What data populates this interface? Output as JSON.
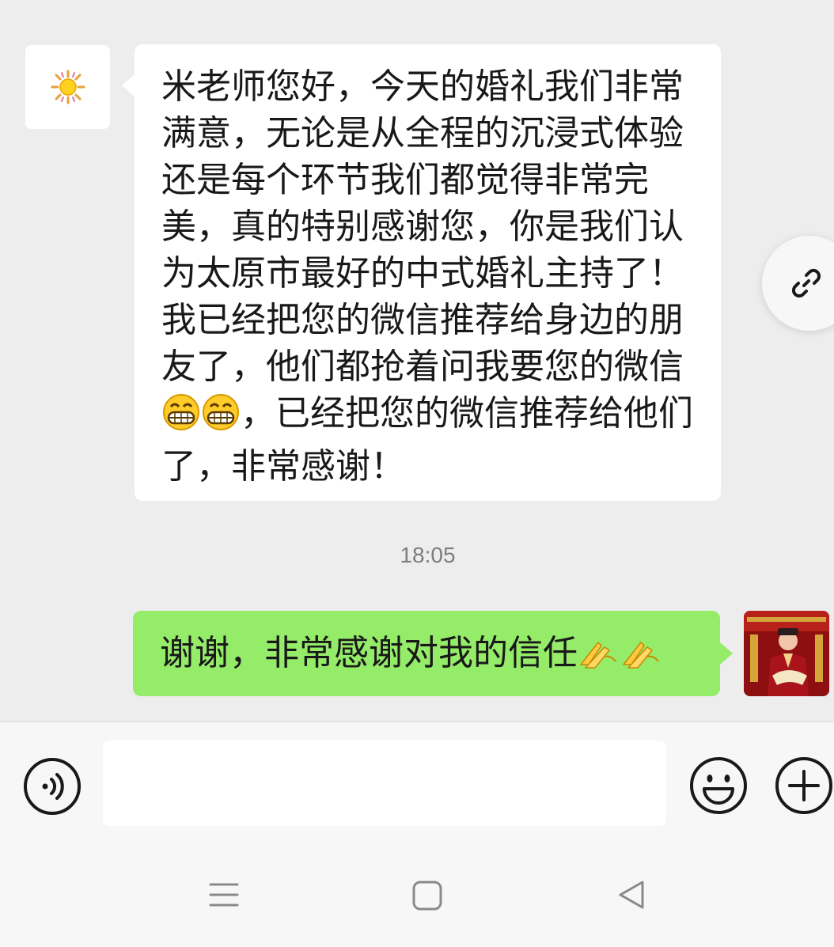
{
  "chat": {
    "incoming_message": {
      "avatar": "sun-emoji-avatar",
      "text_part1": "米老师您好，今天的婚礼我们非常满意，无论是从全程的沉浸式体验还是每个环节我们都觉得非常完美，真的特别感谢您，你是我们认为太原市最好的中式婚礼主持了！我已经把您的微信推荐给身边的朋友了，他们都抢着问我要您的微信",
      "emoji": "grinning-face-emoji",
      "text_part2": "，已经把您的微信推荐给他们了，非常感谢！"
    },
    "timestamp": "18:05",
    "outgoing_message": {
      "text": "谢谢，非常感谢对我的信任",
      "emoji": "folded-hands-emoji"
    }
  },
  "floating": {
    "icon": "link-icon"
  },
  "input_bar": {
    "voice_icon": "voice-icon",
    "input_value": "",
    "emoji_icon": "smiley-icon",
    "plus_icon": "plus-icon"
  },
  "nav": {
    "menu_icon": "menu-icon",
    "home_icon": "home-icon",
    "back_icon": "back-icon"
  },
  "colors": {
    "background": "#ededed",
    "outgoing_bubble": "#95ec69",
    "incoming_bubble": "#ffffff",
    "bar": "#f7f7f7"
  }
}
